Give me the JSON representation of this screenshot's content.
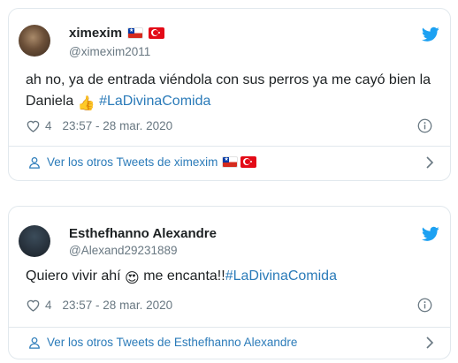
{
  "tweets": [
    {
      "display_name": "ximexim",
      "handle": "@ximexim2011",
      "name_flags": [
        "chile-flag",
        "turkey-flag"
      ],
      "text_main": "ah no, ya de entrada viéndola con sus perros ya me cayó bien la Daniela",
      "emoji": "👍",
      "hashtag": "#LaDivinaComida",
      "likes": "4",
      "timestamp": "23:57 - 28 mar. 2020",
      "more_link": "Ver los otros Tweets de ximexim"
    },
    {
      "display_name": "Esthefhanno Alexandre",
      "handle": "@Alexand29231889",
      "text_pre": "Quiero vivir ahí",
      "emoji": "😍",
      "text_post": "me encanta!!",
      "hashtag": "#LaDivinaComida",
      "likes": "4",
      "timestamp": "23:57 - 28 mar. 2020",
      "more_link": "Ver los otros Tweets de Esthefhanno Alexandre"
    }
  ],
  "colors": {
    "link": "#2b7bb9",
    "muted": "#697882",
    "border": "#e1e8ed",
    "twitter_blue": "#1da1f2"
  },
  "icons": [
    "twitter-bird-icon",
    "heart-icon",
    "info-icon",
    "user-icon",
    "chevron-right-icon"
  ]
}
